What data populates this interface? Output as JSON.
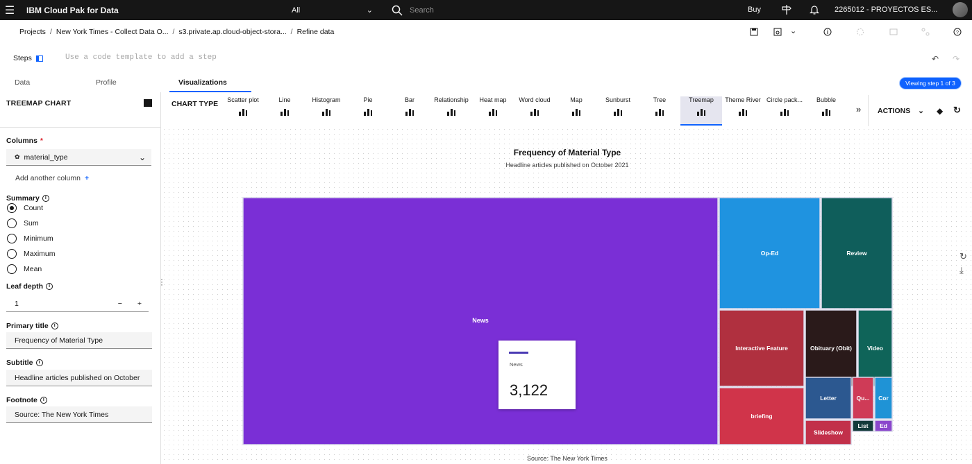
{
  "header": {
    "brand": "IBM Cloud Pak for Data",
    "scope": "All",
    "search_placeholder": "Search",
    "buy": "Buy",
    "account": "2265012 - PROYECTOS ES..."
  },
  "breadcrumb": [
    "Projects",
    "New York Times - Collect Data O...",
    "s3.private.ap.cloud-object-stora...",
    "Refine data"
  ],
  "steps": {
    "label": "Steps",
    "hint": "Use a code template to add a step",
    "viewing": "Viewing step 1 of 3"
  },
  "tabs": [
    "Data",
    "Profile",
    "Visualizations"
  ],
  "sidebar": {
    "title": "TREEMAP CHART",
    "columns_label": "Columns",
    "column_value": "material_type",
    "add_column": "Add another column",
    "summary_label": "Summary",
    "summary_options": [
      "Count",
      "Sum",
      "Minimum",
      "Maximum",
      "Mean"
    ],
    "summary_selected": "Count",
    "leaf_depth_label": "Leaf depth",
    "leaf_depth_value": "1",
    "primary_title_label": "Primary title",
    "primary_title_value": "Frequency of Material Type",
    "subtitle_label": "Subtitle",
    "subtitle_value": "Headline articles published on October",
    "footnote_label": "Footnote",
    "footnote_value": "Source: The New York Times"
  },
  "chart_types": {
    "label": "CHART TYPE",
    "items": [
      "Scatter plot",
      "Line",
      "Histogram",
      "Pie",
      "Bar",
      "Relationship",
      "Heat map",
      "Word cloud",
      "Map",
      "Sunburst",
      "Tree",
      "Treemap",
      "Theme River",
      "Circle pack...",
      "Bubble"
    ],
    "selected": "Treemap",
    "actions": "ACTIONS"
  },
  "chart_data": {
    "type": "treemap",
    "title": "Frequency of Material Type",
    "subtitle": "Headline articles published on October 2021",
    "footnote": "Source: The New York Times",
    "items": [
      {
        "name": "News",
        "value": 3122,
        "color": "#7a2fd6"
      },
      {
        "name": "Op-Ed",
        "color": "#1f93e0"
      },
      {
        "name": "Review",
        "color": "#0f5e5b"
      },
      {
        "name": "Interactive Feature",
        "color": "#b0303f"
      },
      {
        "name": "Obituary (Obit)",
        "color": "#2a1a1a"
      },
      {
        "name": "Video",
        "color": "#0f6459"
      },
      {
        "name": "briefing",
        "color": "#d0344a"
      },
      {
        "name": "Letter",
        "color": "#2c5890"
      },
      {
        "name": "Qu...",
        "color": "#cf3b57"
      },
      {
        "name": "Cor",
        "color": "#1f93d6"
      },
      {
        "name": "Slideshow",
        "color": "#c2304a"
      },
      {
        "name": "List",
        "color": "#123a3a"
      },
      {
        "name": "Ed",
        "color": "#8a46cc"
      }
    ],
    "tooltip": {
      "name": "News",
      "value": "3,122"
    }
  }
}
